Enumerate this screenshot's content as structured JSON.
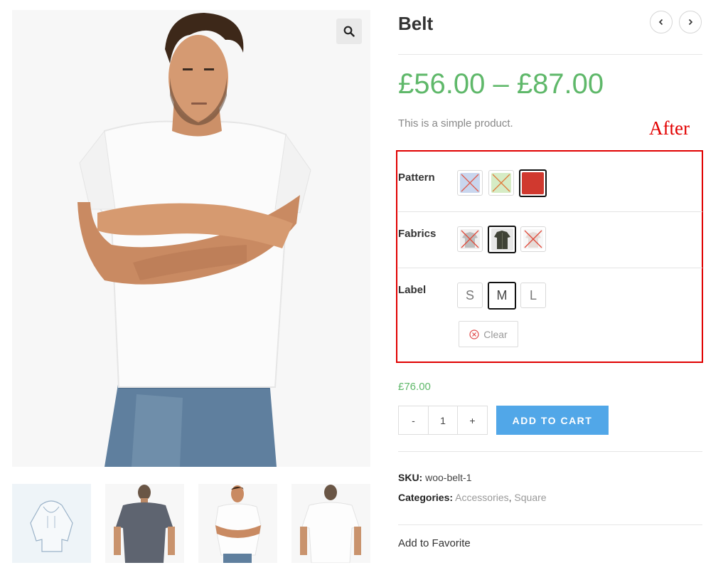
{
  "product": {
    "title": "Belt",
    "price_range": "£56.00 – £87.00",
    "short_description": "This is a simple product.",
    "annotation": "After",
    "variation_price": "£76.00",
    "quantity": "1",
    "minus_label": "-",
    "plus_label": "+",
    "add_to_cart_label": "ADD TO CART"
  },
  "variations": {
    "pattern_label": "Pattern",
    "fabrics_label": "Fabrics",
    "label_label": "Label",
    "pattern_options": [
      {
        "name": "pattern-blue",
        "available": false,
        "color": "#c9d6ee"
      },
      {
        "name": "pattern-green",
        "available": false,
        "color": "#d6ecc5"
      },
      {
        "name": "pattern-red",
        "available": true,
        "selected": true,
        "color": "#d0392f"
      }
    ],
    "label_options": [
      "S",
      "M",
      "L"
    ],
    "label_selected": "M",
    "clear_label": "Clear"
  },
  "meta": {
    "sku_label": "SKU:",
    "sku_value": "woo-belt-1",
    "categories_label": "Categories:",
    "category_1": "Accessories",
    "separator": ",",
    "category_2": "Square"
  },
  "favorite_label": "Add to Favorite",
  "colors": {
    "price_green": "#5fb86a",
    "button_blue": "#51a7e8",
    "annotation_red": "#e00000"
  },
  "icons": [
    "search-icon",
    "chevron-left-icon",
    "chevron-right-icon",
    "clear-circle-icon"
  ]
}
